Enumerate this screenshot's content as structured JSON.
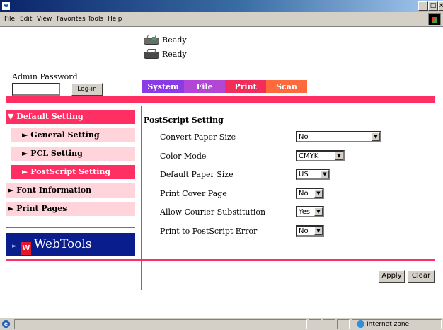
{
  "window": {
    "icon_glyph": "e",
    "min_glyph": "_",
    "max_glyph": "□",
    "close_glyph": "×"
  },
  "menubar": {
    "items": [
      {
        "label": "File",
        "accel": "F"
      },
      {
        "label": "Edit",
        "accel": "E"
      },
      {
        "label": "View",
        "accel": "V"
      },
      {
        "label": "Favorites",
        "accel": "a"
      },
      {
        "label": "Tools",
        "accel": "T"
      },
      {
        "label": "Help",
        "accel": "H"
      }
    ]
  },
  "status": {
    "lines": [
      "Ready",
      "Ready"
    ]
  },
  "admin": {
    "label": "Admin Password",
    "password_value": "",
    "login_label": "Log-in"
  },
  "tabs": [
    "System",
    "File",
    "Print",
    "Scan"
  ],
  "nav": {
    "default_setting": "▼ Default Setting",
    "general_setting": "► General Setting",
    "pcl_setting": "► PCL Setting",
    "postscript_setting": "► PostScript Setting",
    "font_information": "► Font Information",
    "print_pages": "► Print Pages",
    "webtools": "WebTools",
    "webtools_arrow": "►"
  },
  "panel": {
    "title": "PostScript Setting",
    "rows": [
      {
        "label": "Convert Paper Size",
        "value": "No"
      },
      {
        "label": "Color Mode",
        "value": "CMYK"
      },
      {
        "label": "Default Paper Size",
        "value": "US"
      },
      {
        "label": "Print Cover Page",
        "value": "No"
      },
      {
        "label": "Allow Courier Substitution",
        "value": "Yes"
      },
      {
        "label": "Print to PostScript Error",
        "value": "No"
      }
    ]
  },
  "buttons": {
    "apply": "Apply",
    "clear": "Clear"
  },
  "statusbar": {
    "zone": "Internet zone"
  },
  "colors": {
    "accent_pink": "#ff2e63",
    "nav_light": "#ffd4da",
    "tab_system": "#8a3be6",
    "tab_file": "#b446d6",
    "tab_print": "#f22d5a",
    "tab_scan": "#ff6a3d",
    "webtools_bg": "#0a1d8c"
  },
  "icons": [
    "ie-icon",
    "printer-icon",
    "dropdown-arrow-icon",
    "webtools-logo-icon",
    "internet-zone-icon"
  ]
}
